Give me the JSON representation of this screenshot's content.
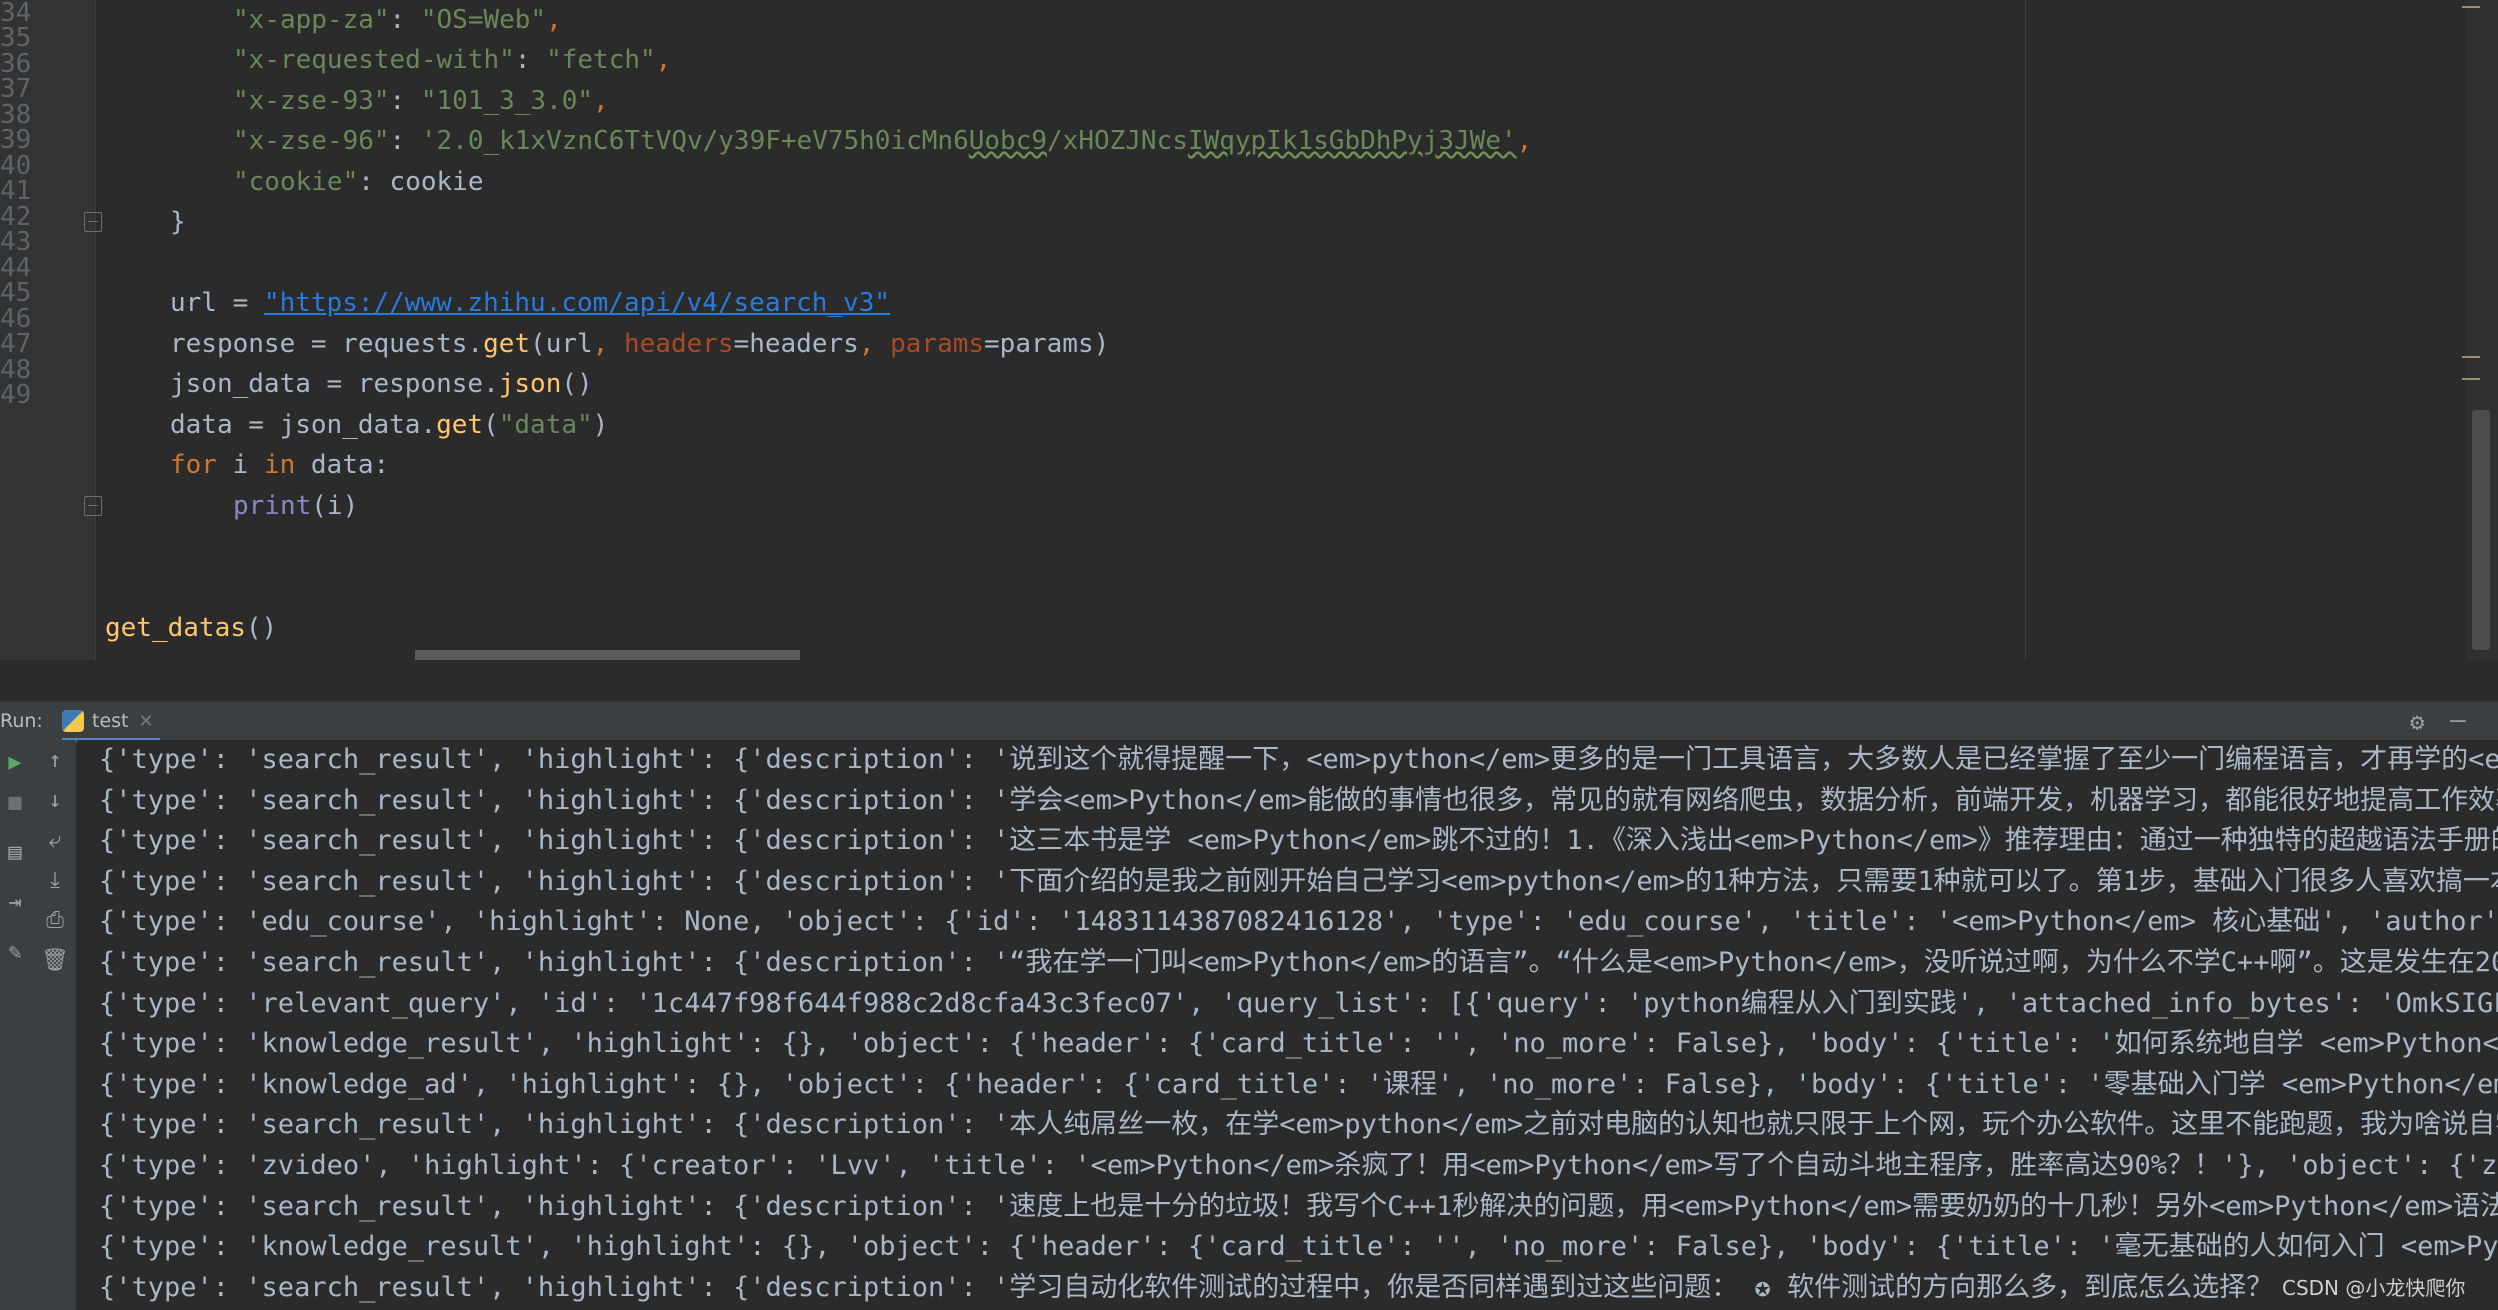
{
  "editor": {
    "line_numbers": [
      "34",
      "35",
      "36",
      "37",
      "38",
      "39",
      "40",
      "41",
      "42",
      "43",
      "44",
      "45",
      "46",
      "47",
      "48",
      "49"
    ],
    "lines": {
      "l34": {
        "key": "\"x-app-za\"",
        "val": "\"OS=Web\"",
        "comma": ","
      },
      "l35": {
        "key": "\"x-requested-with\"",
        "val": "\"fetch\"",
        "comma": ","
      },
      "l36": {
        "key": "\"x-zse-93\"",
        "val": "\"101_3_3.0\"",
        "comma": ","
      },
      "l37": {
        "key": "\"x-zse-96\"",
        "val_a": "'2.0_k1xVznC6TtVQv/y39F+eV75h0icMn6",
        "val_b": "Uobc9",
        "val_c": "/xHOZJNcs",
        "val_d": "IWqypIk1sGbDhPyj3JWe'",
        "comma": ","
      },
      "l38": {
        "key": "\"cookie\"",
        "val": "cookie"
      },
      "l39": {
        "brace": "}"
      },
      "l41": {
        "var": "url = ",
        "url": "\"https://www.zhihu.com/api/v4/search_v3\""
      },
      "l42": {
        "a": "response = requests.",
        "fn": "get",
        "b": "(url",
        "c": ", ",
        "p1": "headers",
        "d": "=headers",
        "e": ", ",
        "p2": "params",
        "f": "=params)"
      },
      "l43": {
        "a": "json_data = response.",
        "fn": "json",
        "b": "()"
      },
      "l44": {
        "a": "data = json_data.",
        "fn": "get",
        "b": "(",
        "s": "\"data\"",
        "c": ")"
      },
      "l45": {
        "kw1": "for",
        "a": " i ",
        "kw2": "in",
        "b": " data:"
      },
      "l46": {
        "bi": "print",
        "a": "(i)"
      },
      "l49": {
        "fn": "get_datas",
        "a": "()"
      }
    }
  },
  "run": {
    "label": "Run:",
    "tab": "test",
    "output": [
      "{'type': 'search_result', 'highlight': {'description': '说到这个就得提醒一下，<em>python</em>更多的是一门工具语言，大多数人是已经掌握了至少一门编程语言，才再学的<em",
      "{'type': 'search_result', 'highlight': {'description': '学会<em>Python</em>能做的事情也很多，常见的就有网络爬虫，数据分析，前端开发，机器学习，都能很好地提高工作效率",
      "{'type': 'search_result', 'highlight': {'description': '这三本书是学 <em>Python</em>跳不过的！1.《深入浅出<em>Python</em>》推荐理由：通过一种独特的超越语法手册的",
      "{'type': 'search_result', 'highlight': {'description': '下面介绍的是我之前刚开始自己学习<em>python</em>的1种方法，只需要1种就可以了。第1步，基础入门很多人喜欢搞一本",
      "{'type': 'edu_course', 'highlight': None, 'object': {'id': '1483114387082416128', 'type': 'edu_course', 'title': '<em>Python</em> 核心基础', 'author':",
      "{'type': 'search_result', 'highlight': {'description': '“我在学一门叫<em>Python</em>的语言”。“什么是<em>Python</em>，没听说过啊，为什么不学C++啊”。这是发生在20",
      "{'type': 'relevant_query', 'id': '1c447f98f644f988c2d8cfa43c3fec07', 'query_list': [{'query': 'python编程从入门到实践', 'attached_info_bytes': 'OmkSIGFl",
      "{'type': 'knowledge_result', 'highlight': {}, 'object': {'header': {'card_title': '', 'no_more': False}, 'body': {'title': '如何系统地自学 <em>Python</",
      "{'type': 'knowledge_ad', 'highlight': {}, 'object': {'header': {'card_title': '课程', 'no_more': False}, 'body': {'title': '零基础入门学 <em>Python</em",
      "{'type': 'search_result', 'highlight': {'description': '本人纯屌丝一枚，在学<em>python</em>之前对电脑的认知也就只限于上个网，玩个办公软件。这里不能跑题，我为啥说自学",
      "{'type': 'zvideo', 'highlight': {'creator': 'Lvv', 'title': '<em>Python</em>杀疯了！用<em>Python</em>写了个自动斗地主程序，胜率高达90%？！'}, 'object': {'zv",
      "{'type': 'search_result', 'highlight': {'description': '速度上也是十分的垃圾！我写个C++1秒解决的问题，用<em>Python</em>需要奶奶的十几秒！另外<em>Python</em>语法",
      "{'type': 'knowledge_result', 'highlight': {}, 'object': {'header': {'card_title': '', 'no_more': False}, 'body': {'title': '毫无基础的人如何入门 <em>Pyth",
      "{'type': 'search_result', 'highlight': {'description': '学习自动化软件测试的过程中，你是否同样遇到过这些问题： ✪ 软件测试的方向那么多，到底怎么选择？"
    ],
    "watermark": "CSDN @小龙快爬你"
  },
  "colors": {
    "background": "#2b2b2b",
    "string": "#6a8759",
    "keyword": "#cc7832",
    "function": "#ffc66d",
    "builtin": "#8888c6",
    "parameter": "#aa4926",
    "url": "#287bde"
  }
}
